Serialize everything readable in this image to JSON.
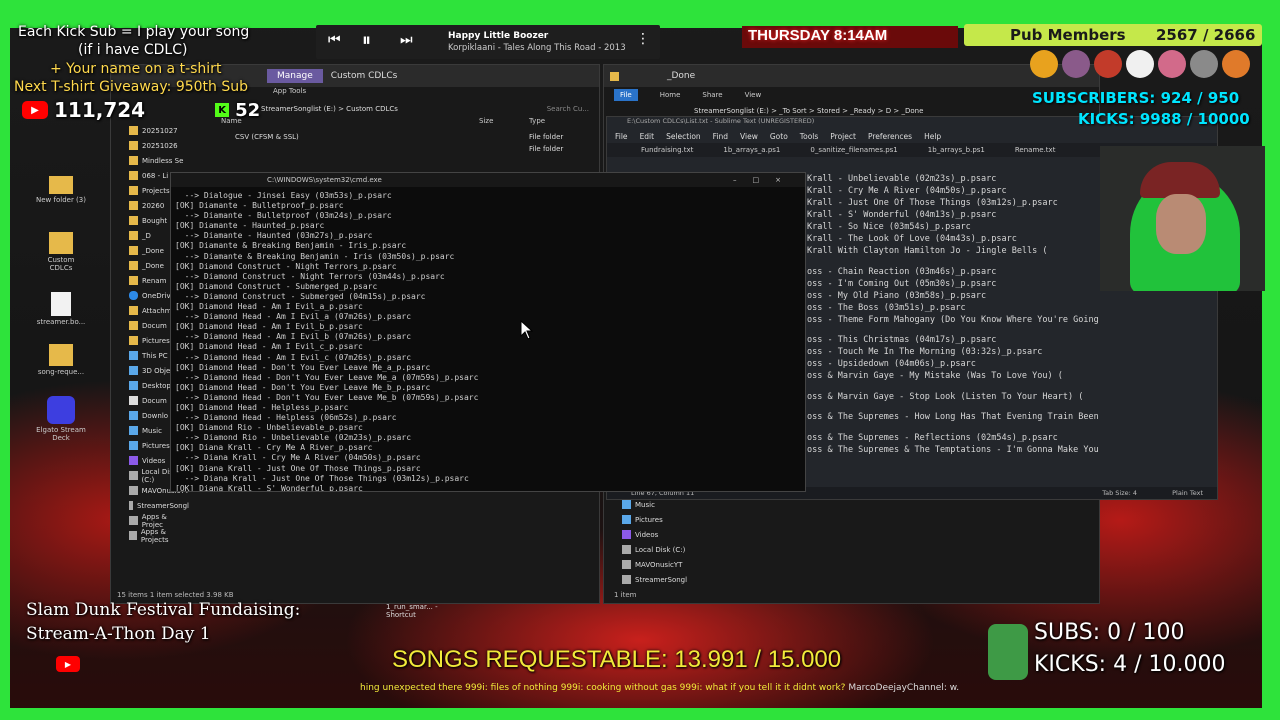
{
  "overlay": {
    "kick_sub_line1": "Each Kick Sub = I play your song",
    "kick_sub_line2": "(if i have CDLC)",
    "tshirt_line1": "+ Your name on a t-shirt",
    "tshirt_line2": "Next T-shirt Giveaway: 950th Sub",
    "youtube_count": "111,724",
    "kick_count": "52",
    "fundraiser_line1": "Slam Dunk Festival Fundaising:",
    "fundraiser_line2": "Stream-A-Thon Day 1",
    "songs_requestable": "SONGS REQUESTABLE: 13.991 / 15.000",
    "ticker": "hing unexpected there 999i: files of nothing 999i: cooking without gas 999i: what if you tell it it didnt work? ",
    "ticker_channel": "MarcoDeejayChannel: w.",
    "subs_goal": "SUBS:  0 / 100",
    "kicks_goal": "KICKS: 4 / 10.000",
    "day_time": "THURSDAY 8:14AM",
    "pub_members_label": "Pub Members",
    "pub_members_count": "2567 / 2666",
    "subscribers_line": "SUBSCRIBERS: 924 / 950",
    "kicks_line": "KICKS: 9988 / 10000"
  },
  "player": {
    "song_title": "Happy Little Boozer",
    "song_artist": "Korpiklaani - Tales Along This Road - 2013",
    "prev_icon": "skip-previous-icon",
    "pause_icon": "pause-icon",
    "next_icon": "skip-next-icon",
    "menu_icon": "more-vertical-icon"
  },
  "desktop_icons": [
    {
      "label": "New folder (3)"
    },
    {
      "label": "Custom CDLCs"
    },
    {
      "label": "streamer.bo..."
    },
    {
      "label": "song-reque..."
    },
    {
      "label": "Elgato Stream Deck"
    }
  ],
  "explorer_left": {
    "manage_tab": "Manage",
    "title": "Custom CDLCs",
    "app_tools": "App Tools",
    "breadcrumb": "StreamerSonglist (E:)  >  Custom CDLCs",
    "search_placeholder": "Search Cu...",
    "col_name": "Name",
    "col_size": "Size",
    "col_type": "Type",
    "row1_name": "CSV (CFSM & SSL)",
    "row1_type": "File folder",
    "row2_type": "File folder",
    "nav_items": [
      "20251027",
      "20251026",
      "Mindless Se",
      "068 - Li",
      "Projects",
      "20260",
      "Bought",
      "_D",
      "_Done",
      "_Done",
      "Renam",
      "OneDrive",
      "Attachm",
      "Docum",
      "Pictures",
      "This PC",
      "3D Obje",
      "Desktop",
      "Docum",
      "Downlo",
      "Music",
      "Pictures",
      "Videos",
      "Local Disk (C:)",
      "MAVOnusicYT",
      "StreamerSongl",
      "Apps & Projec",
      "Apps & Projects"
    ],
    "status": "15 items  1 item selected  3.98 KB"
  },
  "explorer_right": {
    "title": "_Done",
    "ribbon_file": "File",
    "ribbon_home": "Home",
    "ribbon_share": "Share",
    "ribbon_view": "View",
    "breadcrumb": "StreamerSonglist (E:)  >  _To Sort  >  Stored  >  _Ready  >  D  >  _Done",
    "nav_items": [
      "Music",
      "Pictures",
      "Videos",
      "Local Disk (C:)",
      "MAVOnusicYT",
      "StreamerSongl"
    ],
    "status": "1 item"
  },
  "sublime": {
    "path": "E:\\Custom CDLCs\\List.txt - Sublime Text (UNREGISTERED)",
    "menu": [
      "File",
      "Edit",
      "Selection",
      "Find",
      "View",
      "Goto",
      "Tools",
      "Project",
      "Preferences",
      "Help"
    ],
    "tabs": [
      "Fundraising.txt",
      "1b_arrays_a.ps1",
      "0_sanitize_filenames.ps1",
      "1b_arrays_b.ps1",
      "Rename.txt"
    ],
    "lines": [
      "Krall - Unbelievable (02m23s)_p.psarc",
      "Krall - Cry Me A River (04m50s)_p.psarc",
      "Krall - Just One Of Those Things (03m12s)_p.psarc",
      "Krall - S' Wonderful (04m13s)_p.psarc",
      "Krall - So Nice (03m54s)_p.psarc",
      "Krall - The Look Of Love (04m43s)_p.psarc",
      "Krall With Clayton Hamilton Jo - Jingle Bells (",
      "",
      "oss - Chain Reaction (03m46s)_p.psarc",
      "oss - I'm Coming Out (05m30s)_p.psarc",
      "oss - My Old Piano (03m58s)_p.psarc",
      "oss - The Boss (03m51s)_p.psarc",
      "oss - Theme Form Mahogany (Do You Know Where You're Going",
      "",
      "oss - This Christmas (04m17s)_p.psarc",
      "oss - Touch Me In The Morning (03:32s)_p.psarc",
      "oss - Upsidedown (04m06s)_p.psarc",
      "oss & Marvin Gaye - My Mistake (Was To Love You) (",
      "",
      "oss & Marvin Gaye - Stop Look (Listen To Your Heart) (",
      "",
      "oss & The Supremes - How Long Has That Evening Train Been",
      "",
      "oss & The Supremes - Reflections (02m54s)_p.psarc",
      "oss & The Supremes & The Temptations - I'm Gonna Make You"
    ],
    "status_left": "Line 67, Column 11",
    "tab_size": "Tab Size: 4",
    "syntax": "Plain Text"
  },
  "cmd": {
    "title": "C:\\WINDOWS\\system32\\cmd.exe",
    "lines": [
      "  --> Dialogue - Jinsei Easy (03m53s)_p.psarc",
      "[OK] Diamante - Bulletproof_p.psarc",
      "  --> Diamante - Bulletproof (03m24s)_p.psarc",
      "[OK] Diamante - Haunted_p.psarc",
      "  --> Diamante - Haunted (03m27s)_p.psarc",
      "[OK] Diamante & Breaking Benjamin - Iris_p.psarc",
      "  --> Diamante & Breaking Benjamin - Iris (03m50s)_p.psarc",
      "[OK] Diamond Construct - Night Terrors_p.psarc",
      "  --> Diamond Construct - Night Terrors (03m44s)_p.psarc",
      "[OK] Diamond Construct - Submerged_p.psarc",
      "  --> Diamond Construct - Submerged (04m15s)_p.psarc",
      "[OK] Diamond Head - Am I Evil_a_p.psarc",
      "  --> Diamond Head - Am I Evil_a (07m26s)_p.psarc",
      "[OK] Diamond Head - Am I Evil_b_p.psarc",
      "  --> Diamond Head - Am I Evil_b (07m26s)_p.psarc",
      "[OK] Diamond Head - Am I Evil_c_p.psarc",
      "  --> Diamond Head - Am I Evil_c (07m26s)_p.psarc",
      "[OK] Diamond Head - Don't You Ever Leave Me_a_p.psarc",
      "  --> Diamond Head - Don't You Ever Leave Me_a (07m59s)_p.psarc",
      "[OK] Diamond Head - Don't You Ever Leave Me_b_p.psarc",
      "  --> Diamond Head - Don't You Ever Leave Me_b (07m59s)_p.psarc",
      "[OK] Diamond Head - Helpless_p.psarc",
      "  --> Diamond Head - Helpless (06m52s)_p.psarc",
      "[OK] Diamond Rio - Unbelievable_p.psarc",
      "  --> Diamond Rio - Unbelievable (02m23s)_p.psarc",
      "[OK] Diana Krall - Cry Me A River_p.psarc",
      "  --> Diana Krall - Cry Me A River (04m50s)_p.psarc",
      "[OK] Diana Krall - Just One Of Those Things_p.psarc",
      "  --> Diana Krall - Just One Of Those Things (03m12s)_p.psarc",
      "[OK] Diana Krall - S' Wonderful_p.psarc"
    ]
  },
  "shortcut_label": "1_run_smar... - Shortcut",
  "colors": {
    "accent_green": "#2ee33b",
    "time_red": "#d9241b",
    "pub_green": "#c5e84a",
    "songs_yellow": "#f2ea3a",
    "subscriber_cyan": "#00e5ff"
  }
}
